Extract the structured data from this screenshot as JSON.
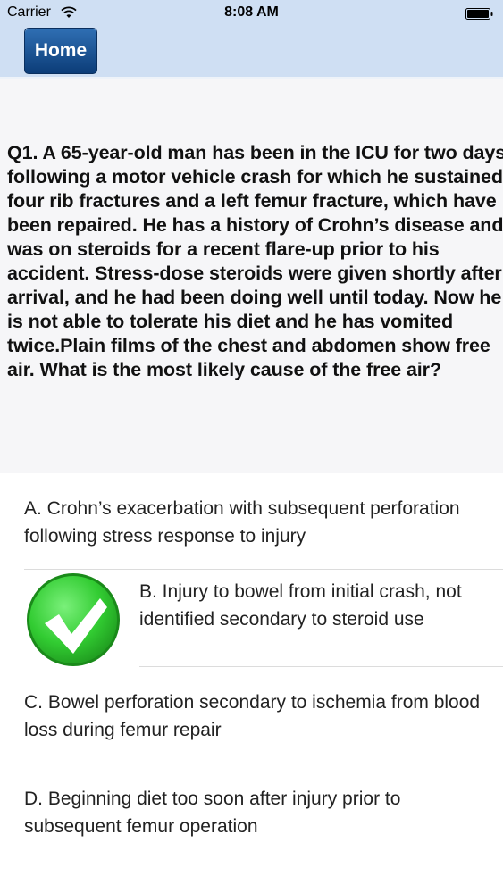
{
  "status_bar": {
    "carrier": "Carrier",
    "time": "8:08 AM",
    "wifi_icon": "wifi-icon",
    "battery_icon": "battery-icon"
  },
  "nav": {
    "home_label": "Home"
  },
  "question": {
    "text": "Q1. A 65-year-old man has been in the ICU for two days following a motor vehicle crash for which he sustained four rib fractures and a left femur fracture, which have been repaired. He has a history of Crohn’s disease and was on steroids for a recent flare-up prior to his accident. Stress-dose steroids were given shortly after arrival, and he had been doing well until today. Now he is not able to tolerate his diet and he has vomited twice.Plain films of the chest and abdomen show free air. What is the most likely cause of the free air?"
  },
  "answers": [
    {
      "text": "A. Crohn’s exacerbation with subsequent perforation following stress response to injury"
    },
    {
      "text": "B. Injury to bowel from initial crash, not identified secondary to steroid use",
      "marked_correct": true,
      "icon": "green-check-icon"
    },
    {
      "text": "C. Bowel perforation secondary to ischemia from blood loss during femur repair"
    },
    {
      "text": "D. Beginning diet too soon after injury prior to subsequent femur operation"
    }
  ],
  "colors": {
    "header_bg": "#cfdff3",
    "home_button": "#1a528f",
    "check_green": "#3bd43b"
  }
}
